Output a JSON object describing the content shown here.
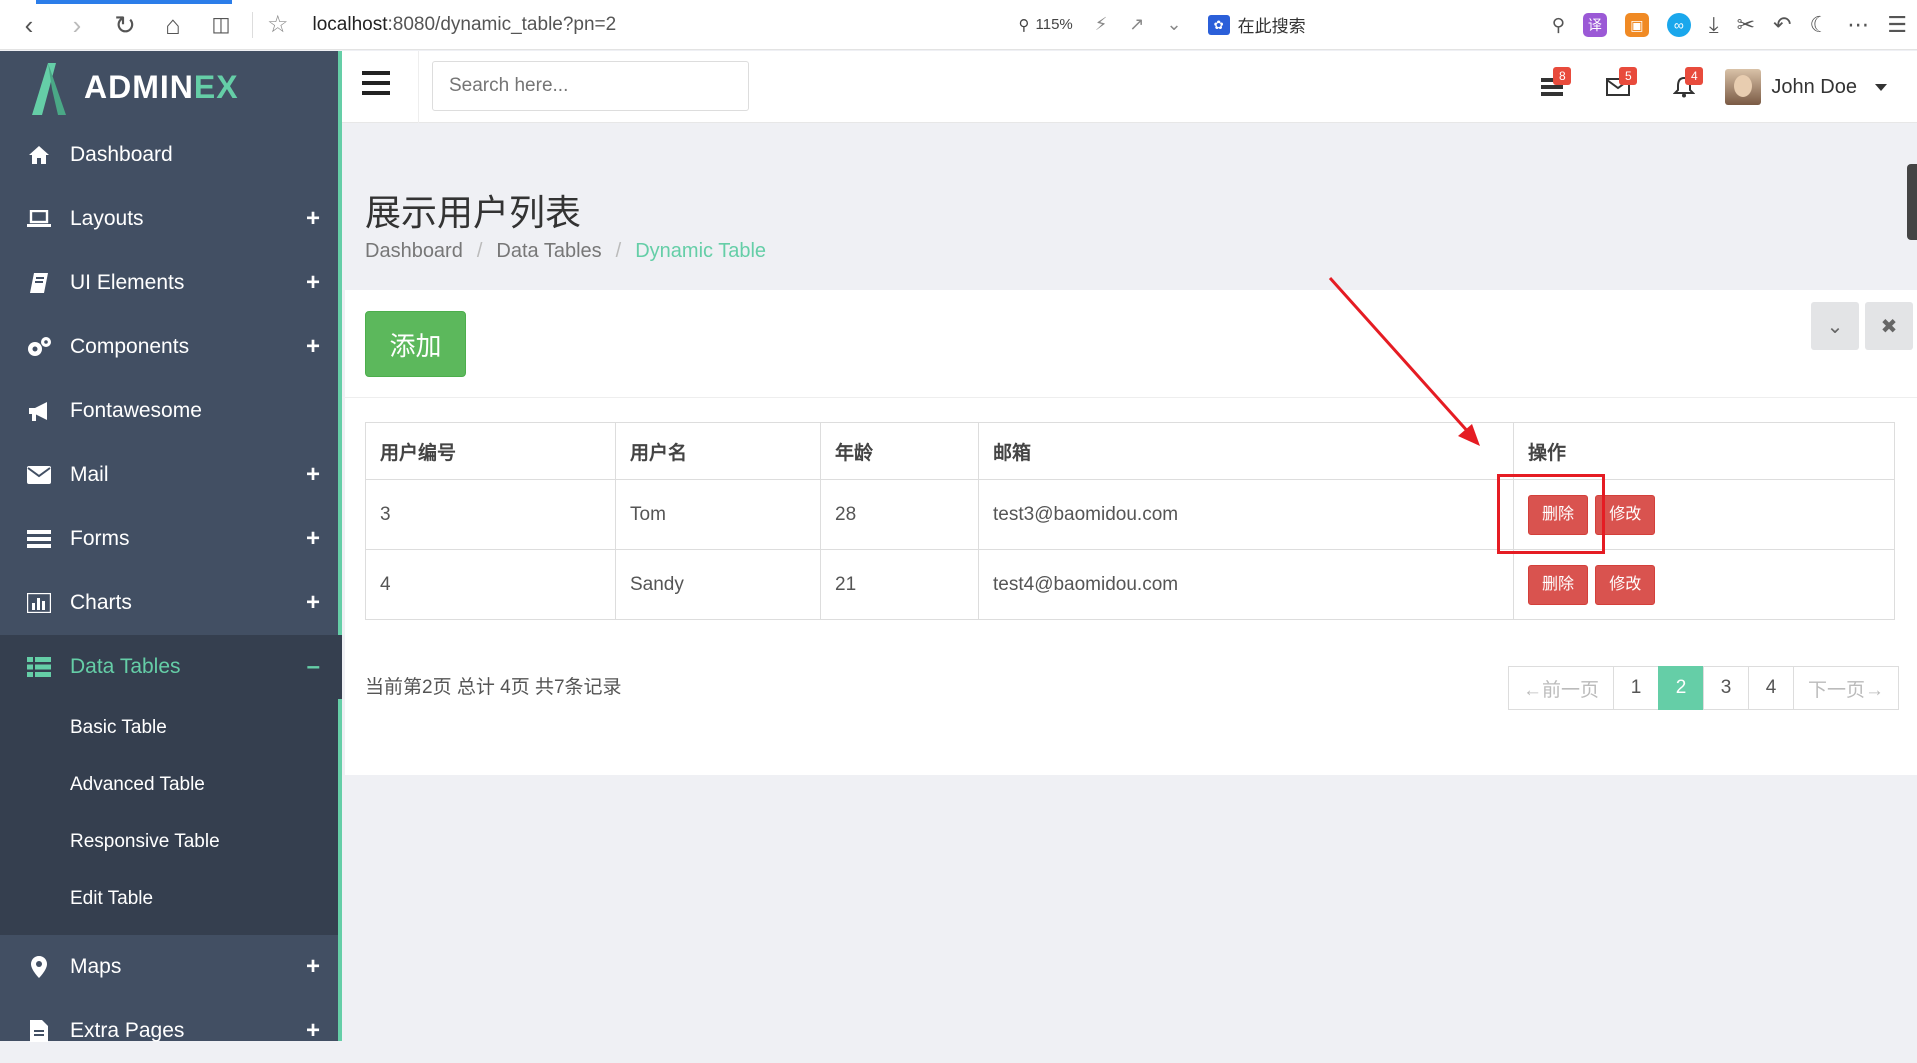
{
  "browser": {
    "url_host": "localhost",
    "url_path": ":8080/dynamic_table?pn=2",
    "zoom": "115%",
    "search_engine_label": "在此搜索"
  },
  "sidebar": {
    "logo_main": "ADMIN",
    "logo_accent": "EX",
    "items": [
      {
        "label": "Dashboard",
        "icon": "home-icon",
        "expandable": false
      },
      {
        "label": "Layouts",
        "icon": "laptop-icon",
        "expandable": true
      },
      {
        "label": "UI Elements",
        "icon": "book-icon",
        "expandable": true
      },
      {
        "label": "Components",
        "icon": "cogs-icon",
        "expandable": true
      },
      {
        "label": "Fontawesome",
        "icon": "bullhorn-icon",
        "expandable": false
      },
      {
        "label": "Mail",
        "icon": "envelope-icon",
        "expandable": true
      },
      {
        "label": "Forms",
        "icon": "tasks-icon",
        "expandable": true
      },
      {
        "label": "Charts",
        "icon": "bar-chart-icon",
        "expandable": true
      },
      {
        "label": "Data Tables",
        "icon": "th-list-icon",
        "expandable": true,
        "active": true
      },
      {
        "label": "Maps",
        "icon": "map-marker-icon",
        "expandable": true
      },
      {
        "label": "Extra Pages",
        "icon": "file-icon",
        "expandable": true
      }
    ],
    "submenu": [
      "Basic Table",
      "Advanced Table",
      "Responsive Table",
      "Edit Table"
    ]
  },
  "topbar": {
    "search_placeholder": "Search here...",
    "badges": {
      "tasks": "8",
      "mail": "5",
      "notifications": "4"
    },
    "user_name": "John Doe"
  },
  "page": {
    "title": "展示用户列表",
    "breadcrumb": [
      "Dashboard",
      "Data Tables",
      "Dynamic Table"
    ]
  },
  "panel": {
    "add_label": "添加",
    "table": {
      "headers": [
        "用户编号",
        "用户名",
        "年龄",
        "邮箱",
        "操作"
      ],
      "rows": [
        {
          "id": "3",
          "name": "Tom",
          "age": "28",
          "email": "test3@baomidou.com"
        },
        {
          "id": "4",
          "name": "Sandy",
          "age": "21",
          "email": "test4@baomidou.com"
        }
      ],
      "delete_label": "删除",
      "edit_label": "修改"
    },
    "info": "当前第2页 总计 4页 共7条记录",
    "pagination": {
      "prev": "←前一页",
      "pages": [
        "1",
        "2",
        "3",
        "4"
      ],
      "current": "2",
      "next": "下一页→"
    }
  },
  "colors": {
    "accent": "#65cea7",
    "sidebar": "#424f63",
    "danger": "#d9534f",
    "success": "#5cb85c",
    "annotation": "#e51c23"
  }
}
